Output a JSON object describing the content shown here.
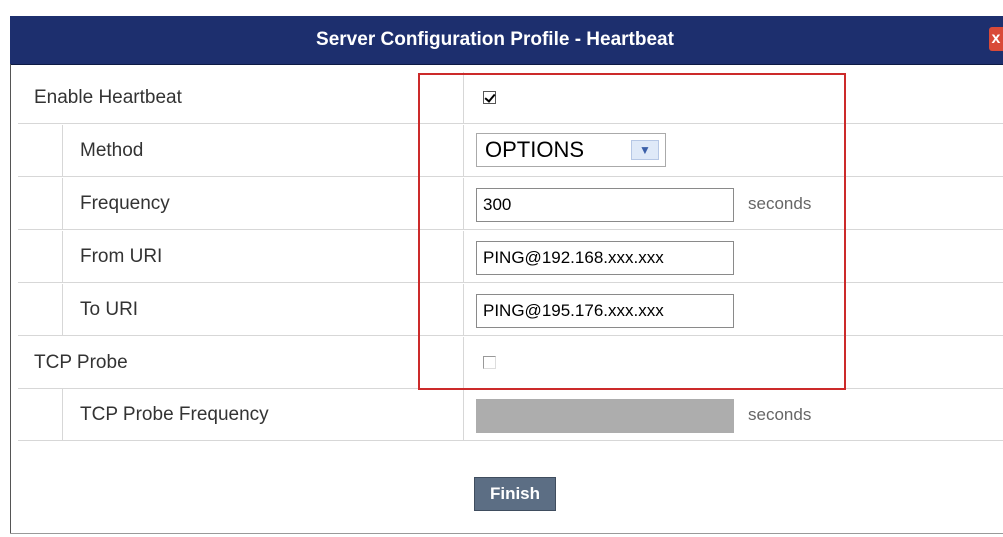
{
  "dialog": {
    "title": "Server Configuration Profile - Heartbeat",
    "close_label": "x"
  },
  "fields": {
    "enable_heartbeat": {
      "label": "Enable Heartbeat",
      "checked": true
    },
    "method": {
      "label": "Method",
      "value": "OPTIONS"
    },
    "frequency": {
      "label": "Frequency",
      "value": "300",
      "unit": "seconds"
    },
    "from_uri": {
      "label": "From URI",
      "value": "PING@192.168.xxx.xxx"
    },
    "to_uri": {
      "label": "To URI",
      "value": "PING@195.176.xxx.xxx"
    },
    "tcp_probe": {
      "label": "TCP Probe",
      "checked": false
    },
    "tcp_probe_frequency": {
      "label": "TCP Probe Frequency",
      "value": "",
      "unit": "seconds"
    }
  },
  "actions": {
    "finish_label": "Finish"
  },
  "colors": {
    "titlebar": "#1d2f6e",
    "highlight": "#cc2a2a",
    "finish_button": "#5c6e84",
    "disabled_field": "#adadad"
  }
}
